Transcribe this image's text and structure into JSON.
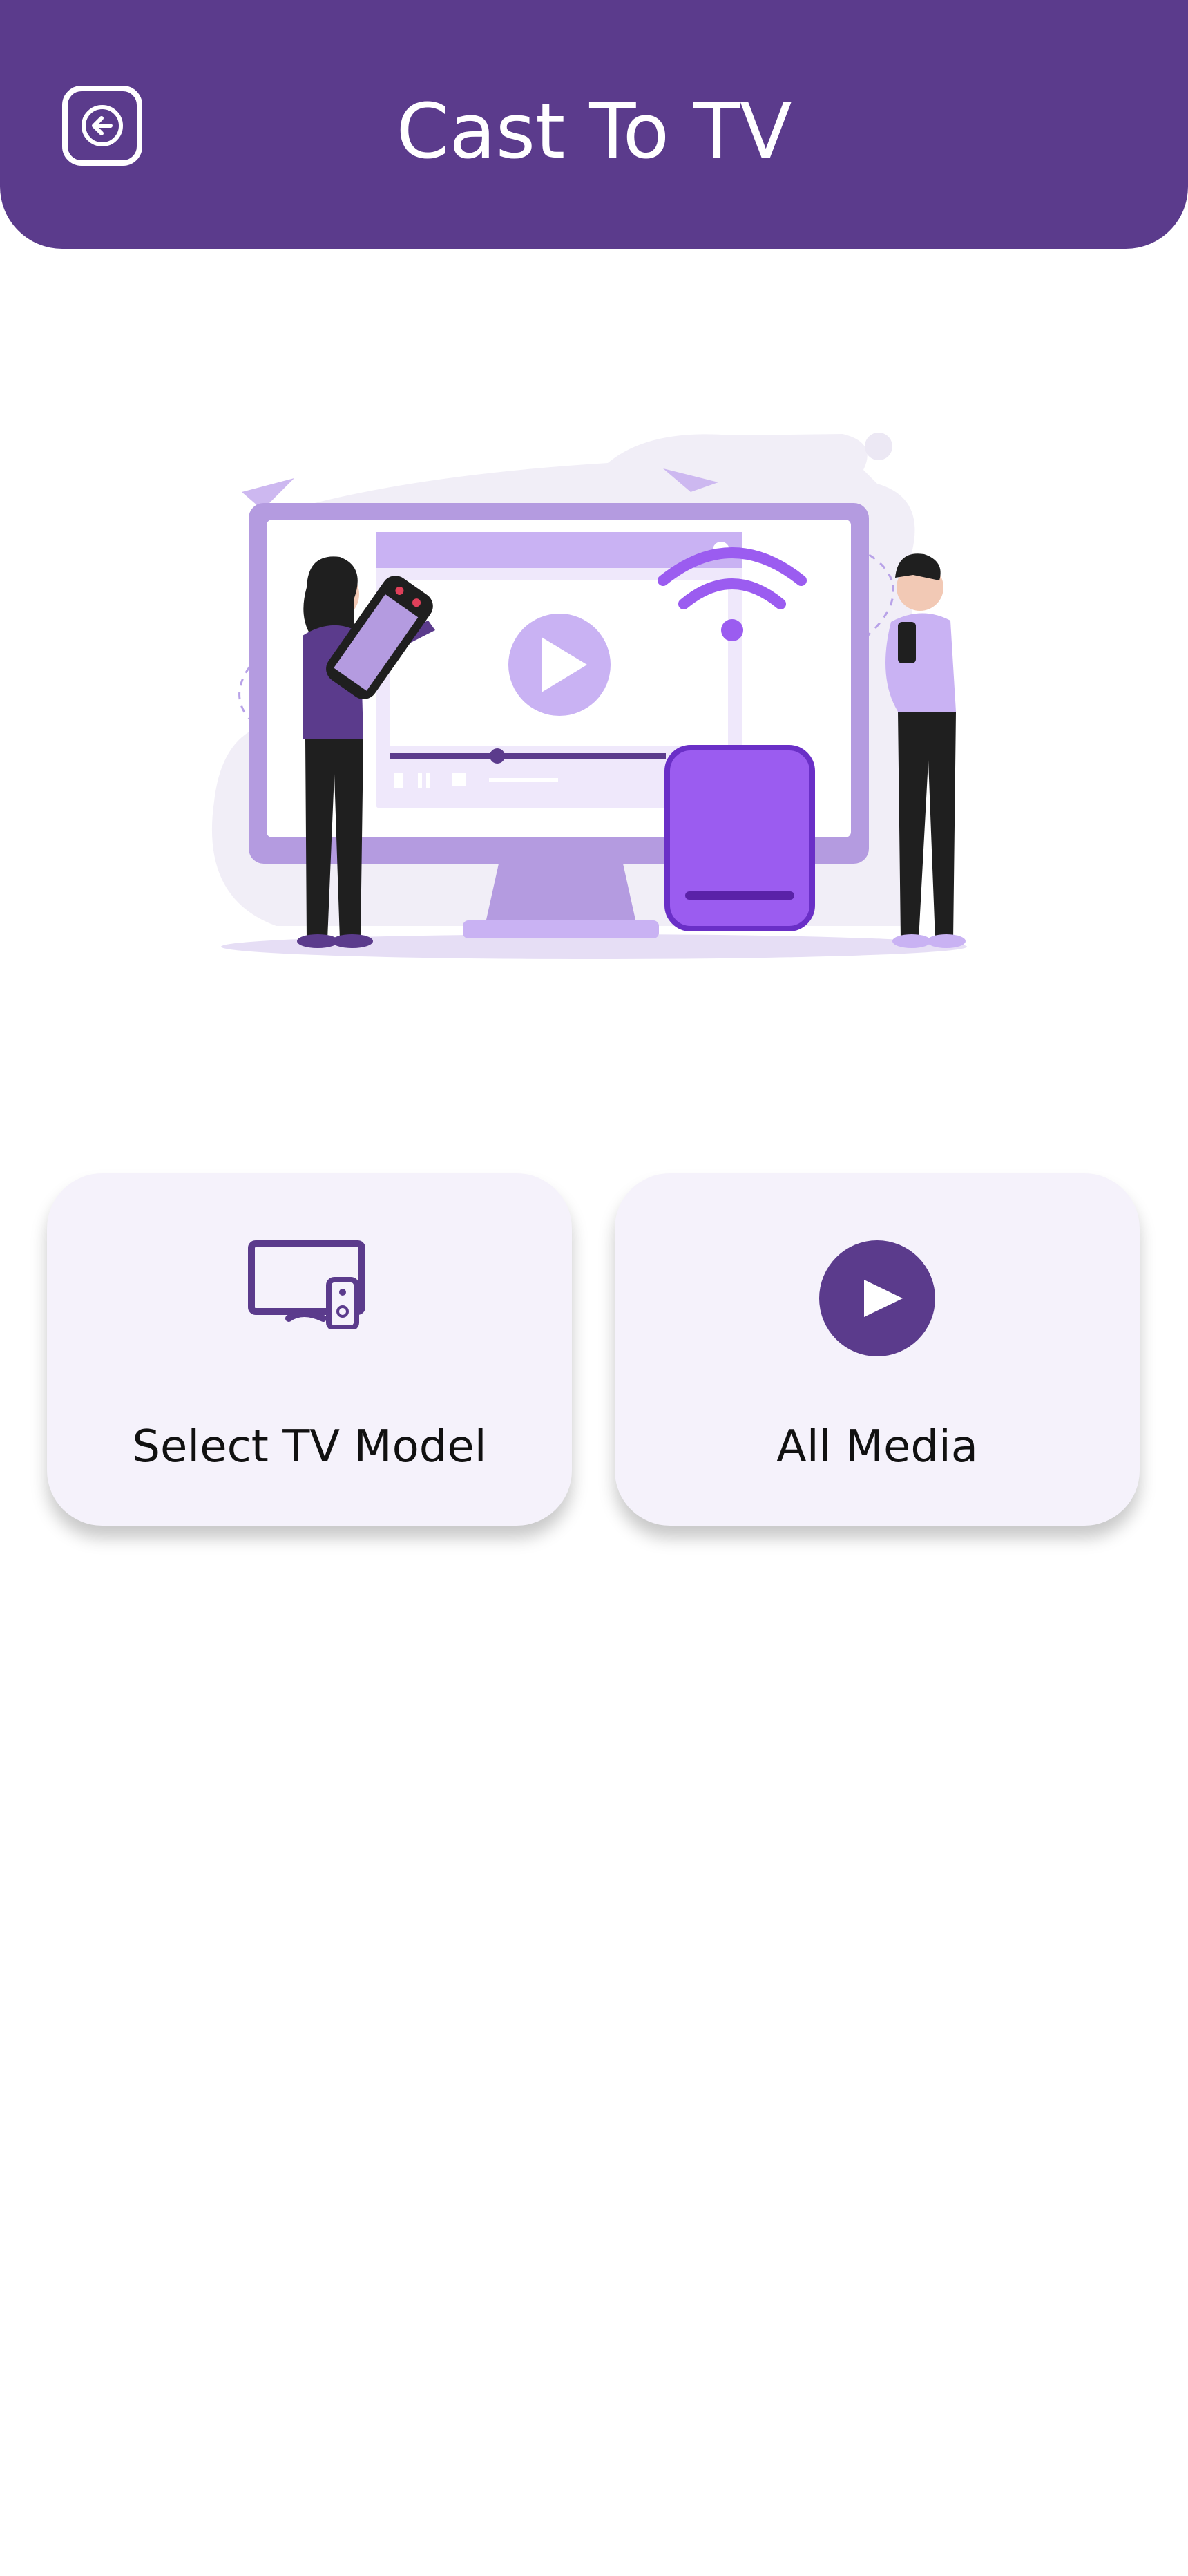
{
  "header": {
    "title": "Cast To TV",
    "back_icon": "arrow-left-square-icon",
    "background_color": "#5b3b8c"
  },
  "hero": {
    "illustration": "casting-illustration",
    "accent_color": "#9b5cf0"
  },
  "actions": [
    {
      "label": "Select TV Model",
      "icon": "tv-remote-icon"
    },
    {
      "label": "All Media",
      "icon": "play-circle-icon"
    }
  ],
  "colors": {
    "brand": "#5b3b8c",
    "card_background": "#f5f2fb",
    "text": "#111111"
  }
}
